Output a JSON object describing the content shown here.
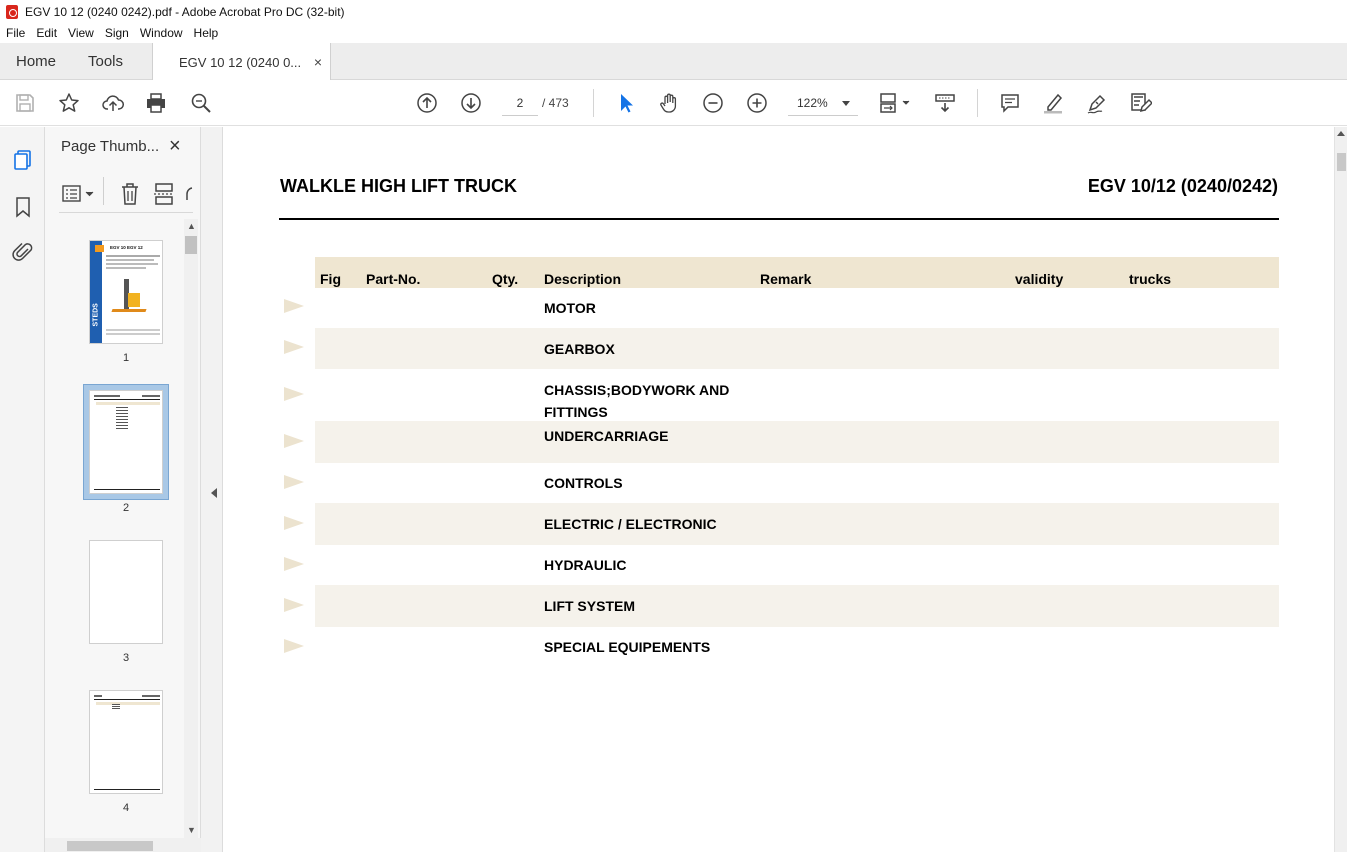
{
  "window": {
    "title": "EGV 10 12 (0240 0242).pdf - Adobe Acrobat Pro DC (32-bit)"
  },
  "menu": [
    "File",
    "Edit",
    "View",
    "Sign",
    "Window",
    "Help"
  ],
  "tabs": {
    "home": "Home",
    "tools": "Tools",
    "doc": "EGV 10 12 (0240 0...",
    "close": "×"
  },
  "toolbar": {
    "current_page": "2",
    "page_total": "/  473",
    "zoom": "122%"
  },
  "thumb_panel": {
    "title": "Page Thumb...",
    "close": "×",
    "pages": [
      {
        "num": "1"
      },
      {
        "num": "2"
      },
      {
        "num": "3"
      },
      {
        "num": "4"
      }
    ],
    "cover_brand": "STEDS",
    "cover_models": "EGV 10  EGV 12"
  },
  "document": {
    "title": "WALKLE HIGH LIFT TRUCK",
    "model": "EGV 10/12 (0240/0242)",
    "columns": [
      "Fig",
      "Part-No.",
      "Qty.",
      "Description",
      "Remark",
      "validity",
      "trucks"
    ],
    "rows": [
      "MOTOR",
      "GEARBOX",
      "CHASSIS;BODYWORK AND FITTINGS",
      "UNDERCARRIAGE",
      "CONTROLS",
      "ELECTRIC / ELECTRONIC",
      "HYDRAULIC",
      "LIFT SYSTEM",
      "SPECIAL EQUIPEMENTS"
    ]
  },
  "colors": {
    "header_band": "#efe6d1",
    "row_shade": "#f5f2eb",
    "arrow": "#ece3cf",
    "select_tool": "#1473e6"
  }
}
